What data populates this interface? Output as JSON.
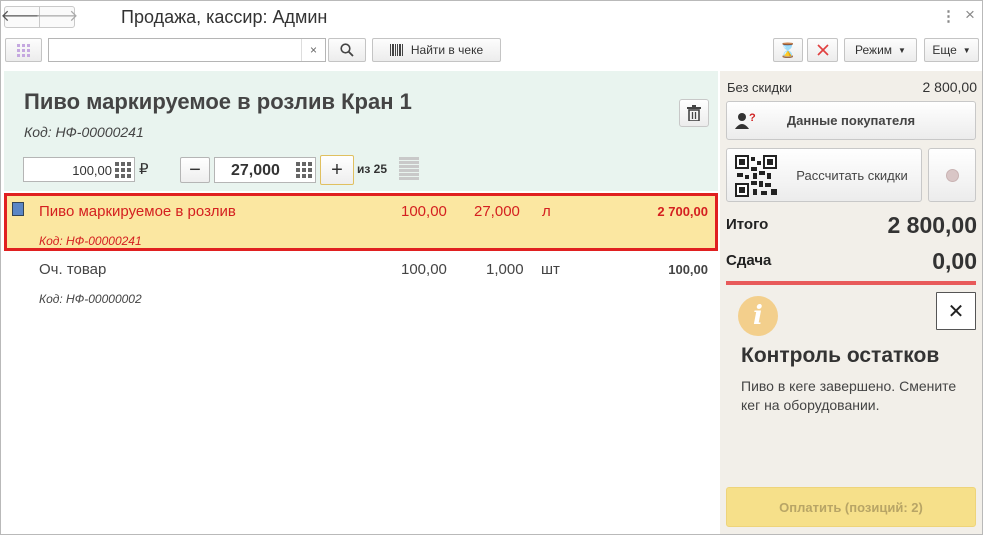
{
  "window": {
    "title": "Продажа, кассир: Админ"
  },
  "toolbar": {
    "search_value": "",
    "search_placeholder": "",
    "clear_label": "×",
    "find_label": "Найти в чеке",
    "mode_label": "Режим",
    "more_label": "Еще"
  },
  "item": {
    "name": "Пиво маркируемое в розлив Кран 1",
    "code": "Код: НФ-00000241",
    "price": "100,00",
    "currency": "₽",
    "quantity": "27,000",
    "of_label": "из 25",
    "minus_label": "−",
    "plus_label": "+"
  },
  "receipt": {
    "rows": [
      {
        "name": "Пиво маркируемое в розлив",
        "price": "100,00",
        "qty": "27,000",
        "unit": "л",
        "sum": "2 700,00",
        "code": "Код: НФ-00000241"
      },
      {
        "name": "Оч. товар",
        "price": "100,00",
        "qty": "1,000",
        "unit": "шт",
        "sum": "100,00",
        "code": "Код: НФ-00000002"
      }
    ]
  },
  "panel": {
    "no_discount_label": "Без скидки",
    "no_discount_value": "2 800,00",
    "customer_label": "Данные покупателя",
    "discount_label": "Рассчитать скидки",
    "total_label": "Итого",
    "total_value": "2 800,00",
    "change_label": "Сдача",
    "change_value": "0,00",
    "close_label": "✕",
    "info_title": "Контроль остатков",
    "info_text": "Пиво в кеге завершено. Смените кег на оборудовании.",
    "pay_label": "Оплатить (позиций: 2)"
  },
  "colors": {
    "selected_row_bg": "#fbe7a1",
    "selected_row_border": "#e02020",
    "selected_text": "#d42020",
    "header_bg": "#e9f4ef",
    "panel_bg": "#f2efe9",
    "pay_bg": "#f6e08a",
    "info_icon": "#f3cf8c"
  }
}
